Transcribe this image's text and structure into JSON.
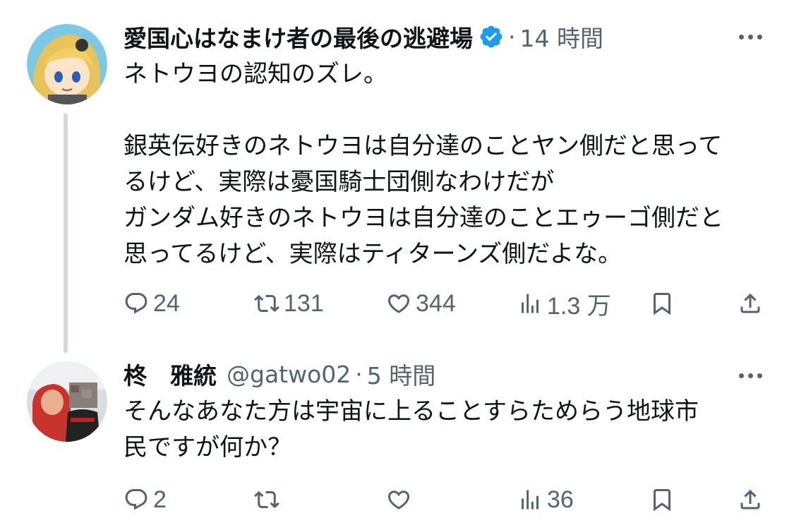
{
  "tweets": [
    {
      "display_name": "愛国心はなまけ者の最後の逃避場",
      "handle": "",
      "verified": true,
      "time": "14 時間",
      "lines": [
        "ネトウヨの認知のズレ。",
        "",
        "銀英伝好きのネトウヨは自分達のことヤン側だと思って",
        "るけど、実際は憂国騎士団側なわけだが",
        "ガンダム好きのネトウヨは自分達のことエゥーゴ側だと",
        "思ってるけど、実際はティターンズ側だよな。"
      ],
      "replies": "24",
      "retweets": "131",
      "likes": "344",
      "views": "1.3 万"
    },
    {
      "display_name": "柊　雅統",
      "handle": "@gatwo02",
      "verified": false,
      "time": "5 時間",
      "lines": [
        "そんなあなた方は宇宙に上ることすらためらう地球市",
        "民ですが何か？"
      ],
      "replies": "2",
      "retweets": "",
      "likes": "",
      "views": "36"
    }
  ],
  "colors": {
    "text": "#0f1419",
    "secondary": "#536471",
    "verified": "#1d9bf0",
    "thread_line": "#cfd9de"
  },
  "icons": [
    "reply-icon",
    "retweet-icon",
    "like-icon",
    "views-icon",
    "bookmark-icon",
    "share-icon",
    "verified-badge-icon",
    "more-options-icon"
  ]
}
